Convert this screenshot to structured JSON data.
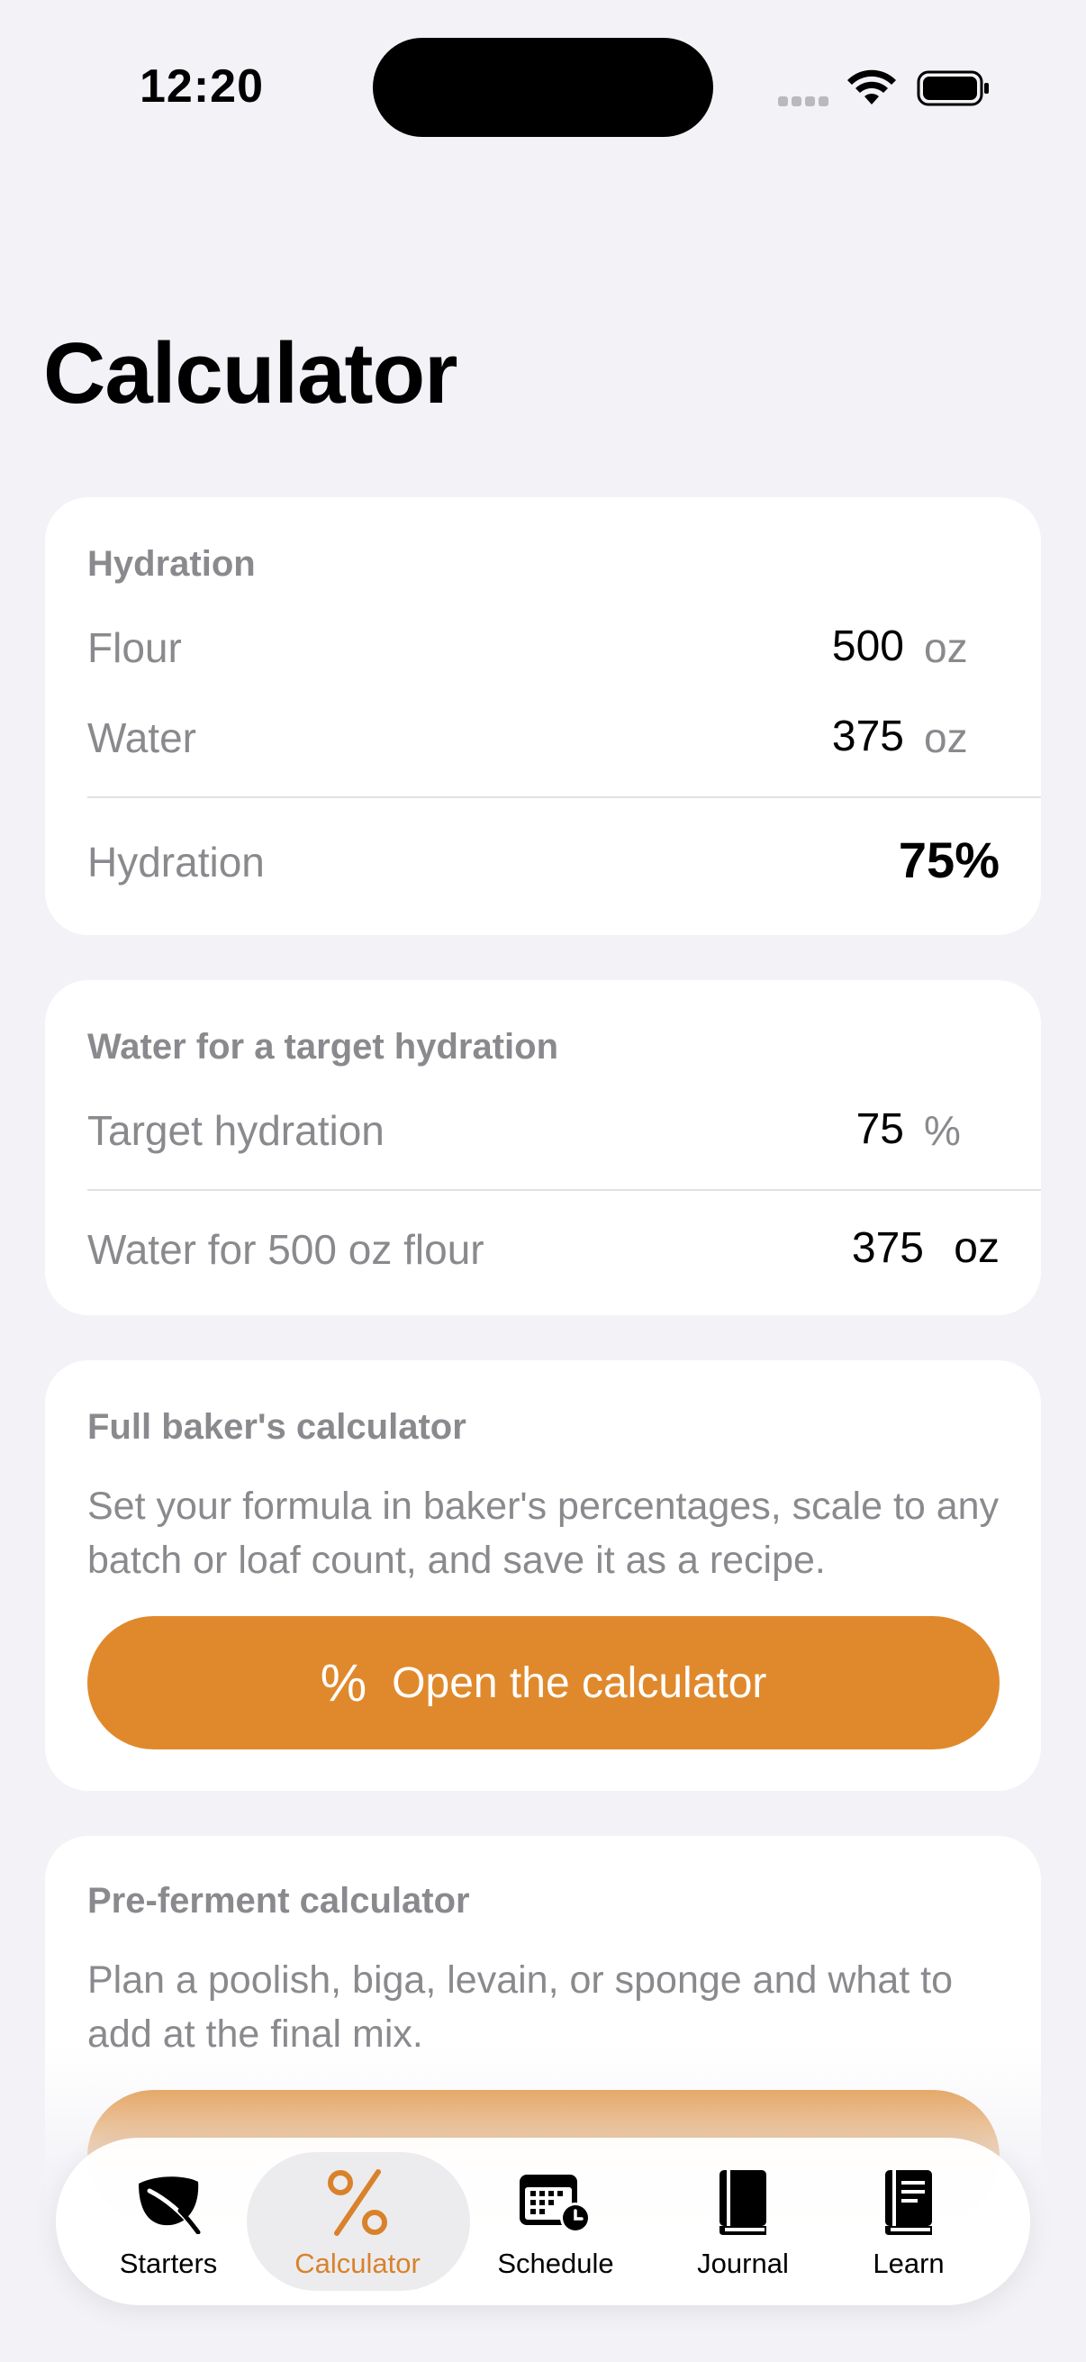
{
  "status_bar": {
    "time": "12:20"
  },
  "title": "Calculator",
  "hydration_card": {
    "header": "Hydration",
    "flour_label": "Flour",
    "flour_value": "500",
    "flour_unit": "oz",
    "water_label": "Water",
    "water_value": "375",
    "water_unit": "oz",
    "result_label": "Hydration",
    "result_value": "75%"
  },
  "target_card": {
    "header": "Water for a target hydration",
    "target_label": "Target hydration",
    "target_value": "75",
    "target_unit": "%",
    "result_label": "Water for 500 oz flour",
    "result_value": "375",
    "result_unit": "oz"
  },
  "baker_card": {
    "header": "Full baker's calculator",
    "description": "Set your formula in baker's percentages, scale to any batch or loaf count, and save it as a recipe.",
    "button_icon": "%",
    "button_label": "Open the calculator"
  },
  "preferment_card": {
    "header": "Pre-ferment calculator",
    "description": "Plan a poolish, biga, levain, or sponge and what to add at the final mix."
  },
  "tab_bar": {
    "active": "Calculator",
    "tabs": [
      {
        "label": "Starters",
        "icon": "leaf-icon"
      },
      {
        "label": "Calculator",
        "icon": "percent-icon"
      },
      {
        "label": "Schedule",
        "icon": "calendar-clock-icon"
      },
      {
        "label": "Journal",
        "icon": "book-icon"
      },
      {
        "label": "Learn",
        "icon": "book-text-icon"
      }
    ]
  },
  "colors": {
    "accent": "#e0892c",
    "background": "#f2f2f7",
    "card": "#ffffff",
    "secondary_text": "#8a8a8e"
  }
}
